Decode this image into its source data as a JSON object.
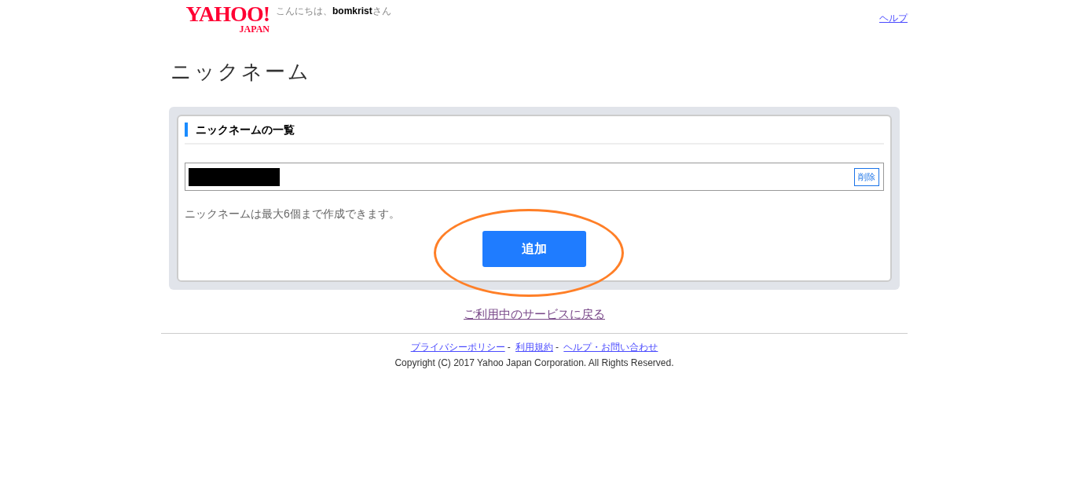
{
  "header": {
    "logo": {
      "main": "YAHOO!",
      "sub": "JAPAN"
    },
    "greeting": {
      "prefix": "こんにちは、",
      "user": "bomkrist",
      "suffix": "さん"
    },
    "help_link": "ヘルプ"
  },
  "title": "ニックネーム",
  "panel": {
    "heading": "ニックネームの一覧",
    "nicknames": [
      {
        "redacted": true,
        "delete_label": "削除"
      }
    ],
    "note": "ニックネームは最大6個まで作成できます。",
    "add_button": "追加",
    "add_button_circled": true
  },
  "back_link": "ご利用中のサービスに戻る",
  "footer": {
    "links": [
      "プライバシーポリシー",
      "利用規約",
      "ヘルプ・お問い合わせ"
    ],
    "separator": "-",
    "copyright": "Copyright (C) 2017 Yahoo Japan Corporation. All Rights Reserved."
  }
}
